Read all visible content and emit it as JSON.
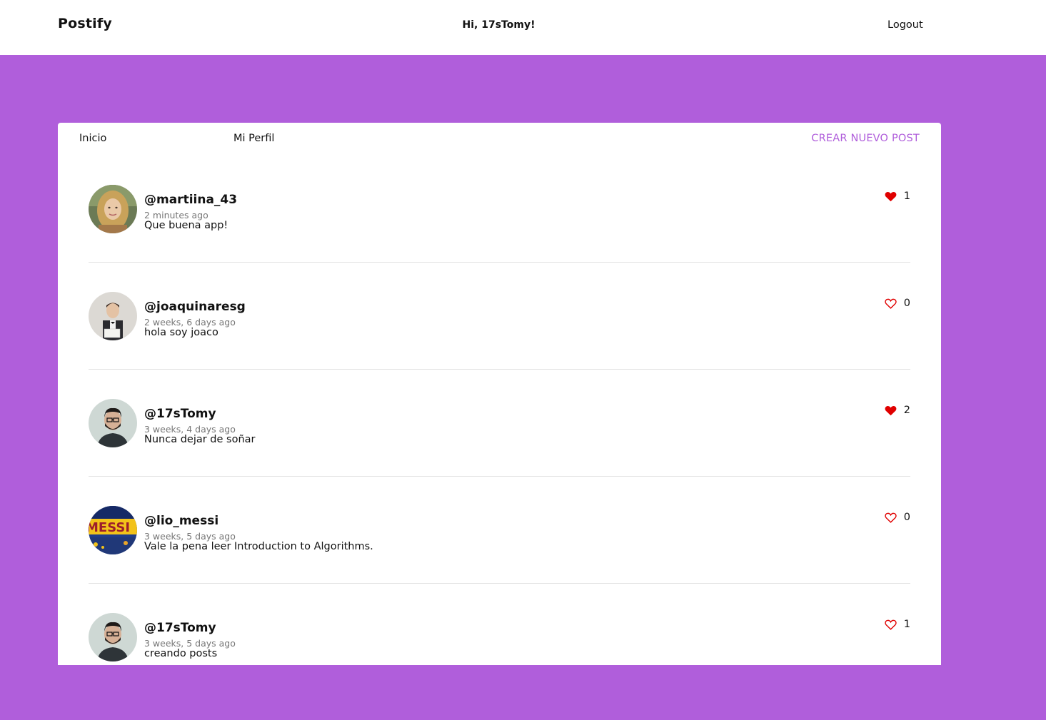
{
  "header": {
    "brand": "Postify",
    "greeting": "Hi, 17sTomy!",
    "logout_label": "Logout"
  },
  "tabs": {
    "home_label": "Inicio",
    "profile_label": "Mi Perfil",
    "create_label": "CREAR NUEVO POST"
  },
  "colors": {
    "accent": "#b05edb",
    "liked_heart": "#e00000"
  },
  "posts": [
    {
      "username": "@martiina_43",
      "time": "2 minutes ago",
      "text": "Que buena app!",
      "likes": "1",
      "liked": true
    },
    {
      "username": "@joaquinaresg",
      "time": "2 weeks, 6 days ago",
      "text": "hola soy joaco",
      "likes": "0",
      "liked": false
    },
    {
      "username": "@17sTomy",
      "time": "3 weeks, 4 days ago",
      "text": "Nunca dejar de soñar",
      "likes": "2",
      "liked": true
    },
    {
      "username": "@lio_messi",
      "time": "3 weeks, 5 days ago",
      "text": "Vale la pena leer Introduction to Algorithms.",
      "likes": "0",
      "liked": false
    },
    {
      "username": "@17sTomy",
      "time": "3 weeks, 5 days ago",
      "text": "creando posts",
      "likes": "1",
      "liked": false
    }
  ]
}
